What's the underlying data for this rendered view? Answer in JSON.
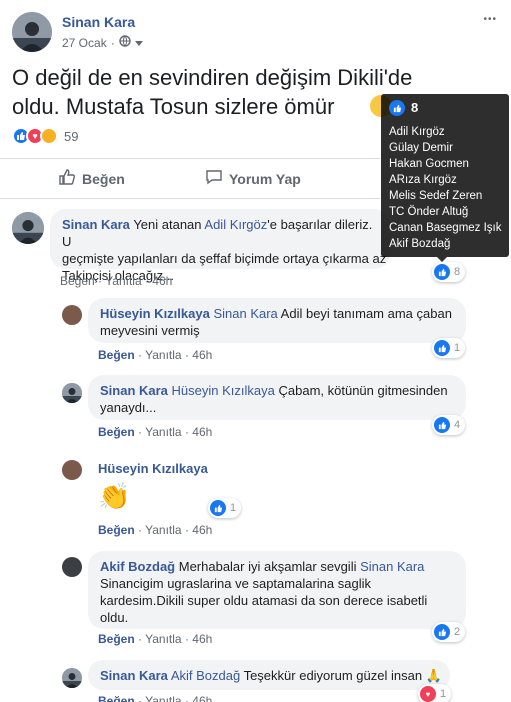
{
  "post": {
    "author": "Sinan Kara",
    "date": "27 Ocak",
    "date_sep": "·",
    "text": "O değil de en sevindiren değişim Dikili'de oldu. Mustafa Tosun sizlere ömür",
    "reaction_count": "59",
    "more": "•••"
  },
  "post_actions": {
    "like": "Beğen",
    "comment": "Yorum Yap"
  },
  "tooltip": {
    "count": "8",
    "names": [
      "Adil Kırgöz",
      "Gülay Demir",
      "Hakan Gocmen",
      "ARıza Kırgöz",
      "Melis Sedef Zeren",
      "TC Önder Altuğ",
      "Canan Basegmez Işık",
      "Akif Bozdağ"
    ]
  },
  "comments": [
    {
      "author": "Sinan Kara",
      "text1": "Yeni atanan ",
      "mention": "Adil Kırgöz",
      "text2": "'e başarılar dileriz. U",
      "line2": "geçmişte yapılanları da şeffaf biçimde ortaya çıkarma az",
      "line3": "Takipçisi olacağız...",
      "like": "Beğen",
      "reply": "Yanıtla",
      "time": "46h",
      "reactions": "8"
    },
    {
      "author": "Hüseyin Kızılkaya",
      "mention": "Sinan Kara",
      "text": " Adil beyi tanımam ama çaban",
      "line2": "meyvesini vermiş",
      "like": "Beğen",
      "reply": "Yanıtla",
      "time": "46h",
      "reactions": "1"
    },
    {
      "author": "Sinan Kara",
      "mention": "Hüseyin Kızılkaya",
      "text": " Çabam, kötünün gitmesinden",
      "line2": "yanaydı...",
      "like": "Beğen",
      "reply": "Yanıtla",
      "time": "46h",
      "reactions": "4"
    },
    {
      "author": "Hüseyin Kızılkaya",
      "emoji": "👏",
      "like": "Beğen",
      "reply": "Yanıtla",
      "time": "46h",
      "reactions": "1"
    },
    {
      "author": "Akif Bozdağ",
      "text": " Merhabalar iyi akşamlar sevgili ",
      "mention": "Sinan Kara",
      "line2": "Sinancigim ugraslarina ve saptamalarina saglik",
      "line3": "kardesim.Dikili super oldu atamasi da son derece isabetli",
      "line4": "oldu.",
      "like": "Beğen",
      "reply": "Yanıtla",
      "time": "46h",
      "reactions": "2"
    },
    {
      "author": "Sinan Kara",
      "mention": "Akif Bozdağ",
      "text": " Teşekkür ediyorum güzel insan",
      "emoji": "🙏",
      "like": "Beğen",
      "reply": "Yanıtla",
      "time": "46h",
      "reactions": "1"
    }
  ],
  "colors": {
    "link": "#385898",
    "like_blue": "#1877f2",
    "bubble": "#f2f3f5",
    "meta": "#606770"
  }
}
